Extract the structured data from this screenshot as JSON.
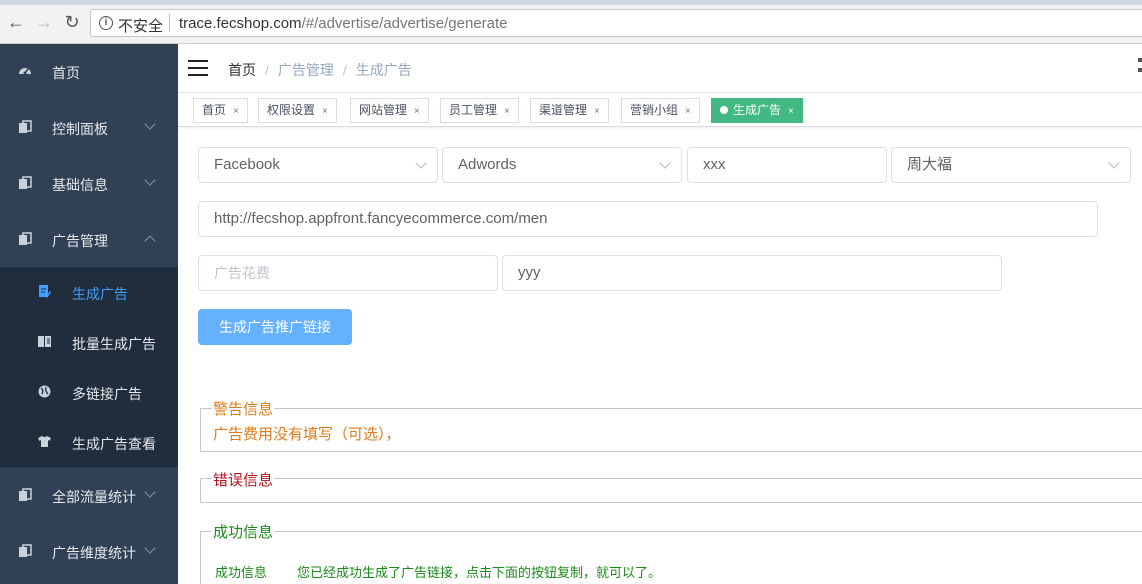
{
  "browser": {
    "insecure_label": "不安全",
    "url_host": "trace.fecshop.com",
    "url_path": "/#/advertise/advertise/generate"
  },
  "sidebar": {
    "items": [
      {
        "label": "首页",
        "icon": "dashboard-icon"
      },
      {
        "label": "控制面板",
        "icon": "copy-icon"
      },
      {
        "label": "基础信息",
        "icon": "copy-icon"
      },
      {
        "label": "广告管理",
        "icon": "copy-icon"
      },
      {
        "label": "全部流量统计",
        "icon": "copy-icon"
      },
      {
        "label": "广告维度统计",
        "icon": "copy-icon"
      }
    ],
    "subitems": [
      {
        "label": "生成广告",
        "icon": "edit-doc-icon"
      },
      {
        "label": "批量生成广告",
        "icon": "book-icon"
      },
      {
        "label": "多链接广告",
        "icon": "globe-icon"
      },
      {
        "label": "生成广告查看",
        "icon": "shirt-icon"
      }
    ]
  },
  "breadcrumb": {
    "home": "首页",
    "level1": "广告管理",
    "level2": "生成广告",
    "sep": "/"
  },
  "tags": [
    "首页",
    "权限设置",
    "网站管理",
    "员工管理",
    "渠道管理",
    "营销小组",
    "生成广告"
  ],
  "tag_close": "×",
  "form": {
    "platform": "Facebook",
    "channel": "Adwords",
    "param1": "xxx",
    "person": "周大福",
    "url": "http://fecshop.appfront.fancyecommerce.com/men",
    "cost_placeholder": "广告花费",
    "param2": "yyy",
    "generate_label": "生成广告推广链接"
  },
  "messages": {
    "warning_title": "警告信息",
    "warning_text": "广告费用没有填写（可选），",
    "error_title": "错误信息",
    "success_title": "成功信息",
    "success_label": "成功信息",
    "success_text": "您已经成功生成了广告链接，点击下面的按钮复制，就可以了。"
  },
  "colors": {
    "sidebar_bg": "#304156",
    "active_tag": "#42b983",
    "accent": "#409eff"
  }
}
